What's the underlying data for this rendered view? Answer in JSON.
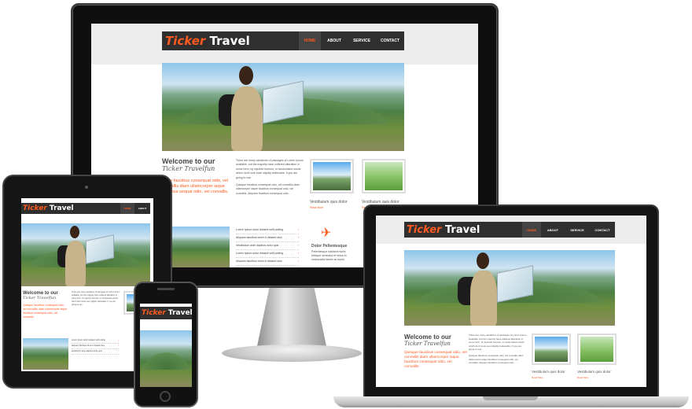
{
  "site": {
    "logo_brand": "Ticker",
    "logo_rest": "Travel",
    "menu": [
      "HOME",
      "ABOUT",
      "SERVICE",
      "CONTACT"
    ],
    "welcome_title": "Welcome to our",
    "welcome_sub": "Ticker Travelfun",
    "welcome_orange": "Quisque faucibus consequat odio, vel convallis diam ullamcorper iaque faucibus consequat odio, vel convallis.",
    "welcome_orange_short": "isque faucibus consequat odio, vel convallis diam ullamcorper iaque faucibus sequat odio, vel convallis.",
    "para1": "There are many variations of passages of Lorem Ipsum available, but the majority have suffered alteration in some form, by injected humour, or randomised words which don't look even slightly believable. If you are going to use",
    "para2": "Quisque faucibus consequat odio, vel convallis diam ullamcorper iaque faucibus consequat odio, vel convallis. Aliquam faucibus consequat odio.",
    "thumb1_caption": "Vestibulum quis dolor",
    "thumb2_caption": "Vestibulum quis dolor",
    "read_more": "Read More",
    "list_items": [
      "Lorem Ipsum dolor distarel velit potting",
      "Aliquam faucibus lorem it distarel duis",
      "Vestibulum ante dapibus dolor quis",
      "Lorem Ipsum dolor distarel velit potting",
      "Aliquam faucibus lorem it distarel duis"
    ],
    "feature_title": "Dolor Pellentesque",
    "feature_text": "Pellentesque habitant morbi tristique senectus et netus et malesuada fames ac turpis"
  },
  "colors": {
    "accent": "#ff5a1f",
    "nav": "#2f2f2f",
    "device_frame": "#141414"
  },
  "icons": {
    "plane": "plane-icon"
  }
}
